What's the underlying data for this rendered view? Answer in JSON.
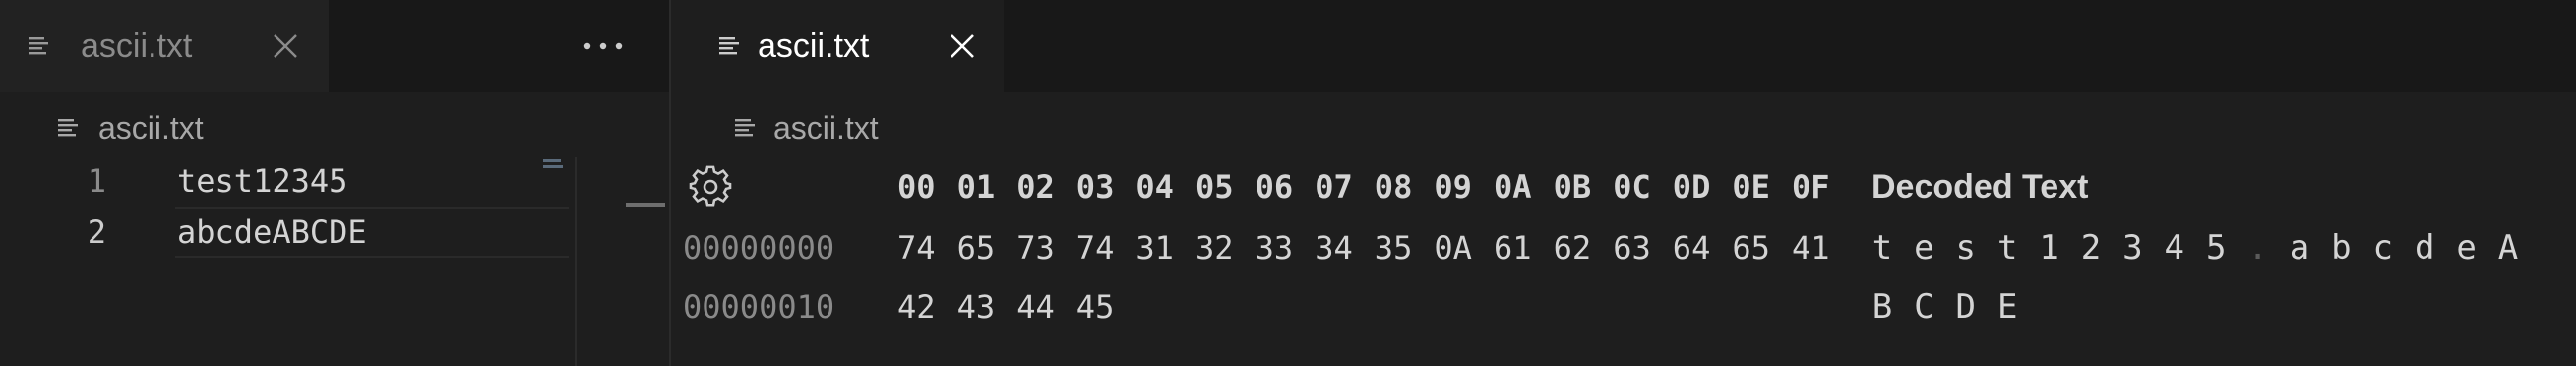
{
  "left_editor": {
    "tab": {
      "label": "ascii.txt",
      "file_icon": "lines-file-icon",
      "close_icon": "close-icon"
    },
    "more_actions_icon": "ellipsis-icon",
    "breadcrumb": {
      "label": "ascii.txt",
      "file_icon": "lines-file-icon"
    },
    "lines": [
      {
        "number": "1",
        "text": "test12345"
      },
      {
        "number": "2",
        "text": "abcdeABCDE"
      }
    ]
  },
  "right_editor": {
    "tab": {
      "label": "ascii.txt",
      "file_icon": "lines-file-icon",
      "close_icon": "close-icon"
    },
    "breadcrumb": {
      "label": "ascii.txt",
      "file_icon": "lines-file-icon"
    },
    "settings_icon": "gear-icon",
    "hex_columns": [
      "00",
      "01",
      "02",
      "03",
      "04",
      "05",
      "06",
      "07",
      "08",
      "09",
      "0A",
      "0B",
      "0C",
      "0D",
      "0E",
      "0F"
    ],
    "decoded_header": "Decoded Text",
    "rows": [
      {
        "offset": "00000000",
        "bytes": [
          "74",
          "65",
          "73",
          "74",
          "31",
          "32",
          "33",
          "34",
          "35",
          "0A",
          "61",
          "62",
          "63",
          "64",
          "65",
          "41"
        ],
        "decoded": [
          "t",
          "e",
          "s",
          "t",
          "1",
          "2",
          "3",
          "4",
          "5",
          ".",
          "a",
          "b",
          "c",
          "d",
          "e",
          "A"
        ]
      },
      {
        "offset": "00000010",
        "bytes": [
          "42",
          "43",
          "44",
          "45"
        ],
        "decoded": [
          "B",
          "C",
          "D",
          "E"
        ]
      }
    ]
  }
}
